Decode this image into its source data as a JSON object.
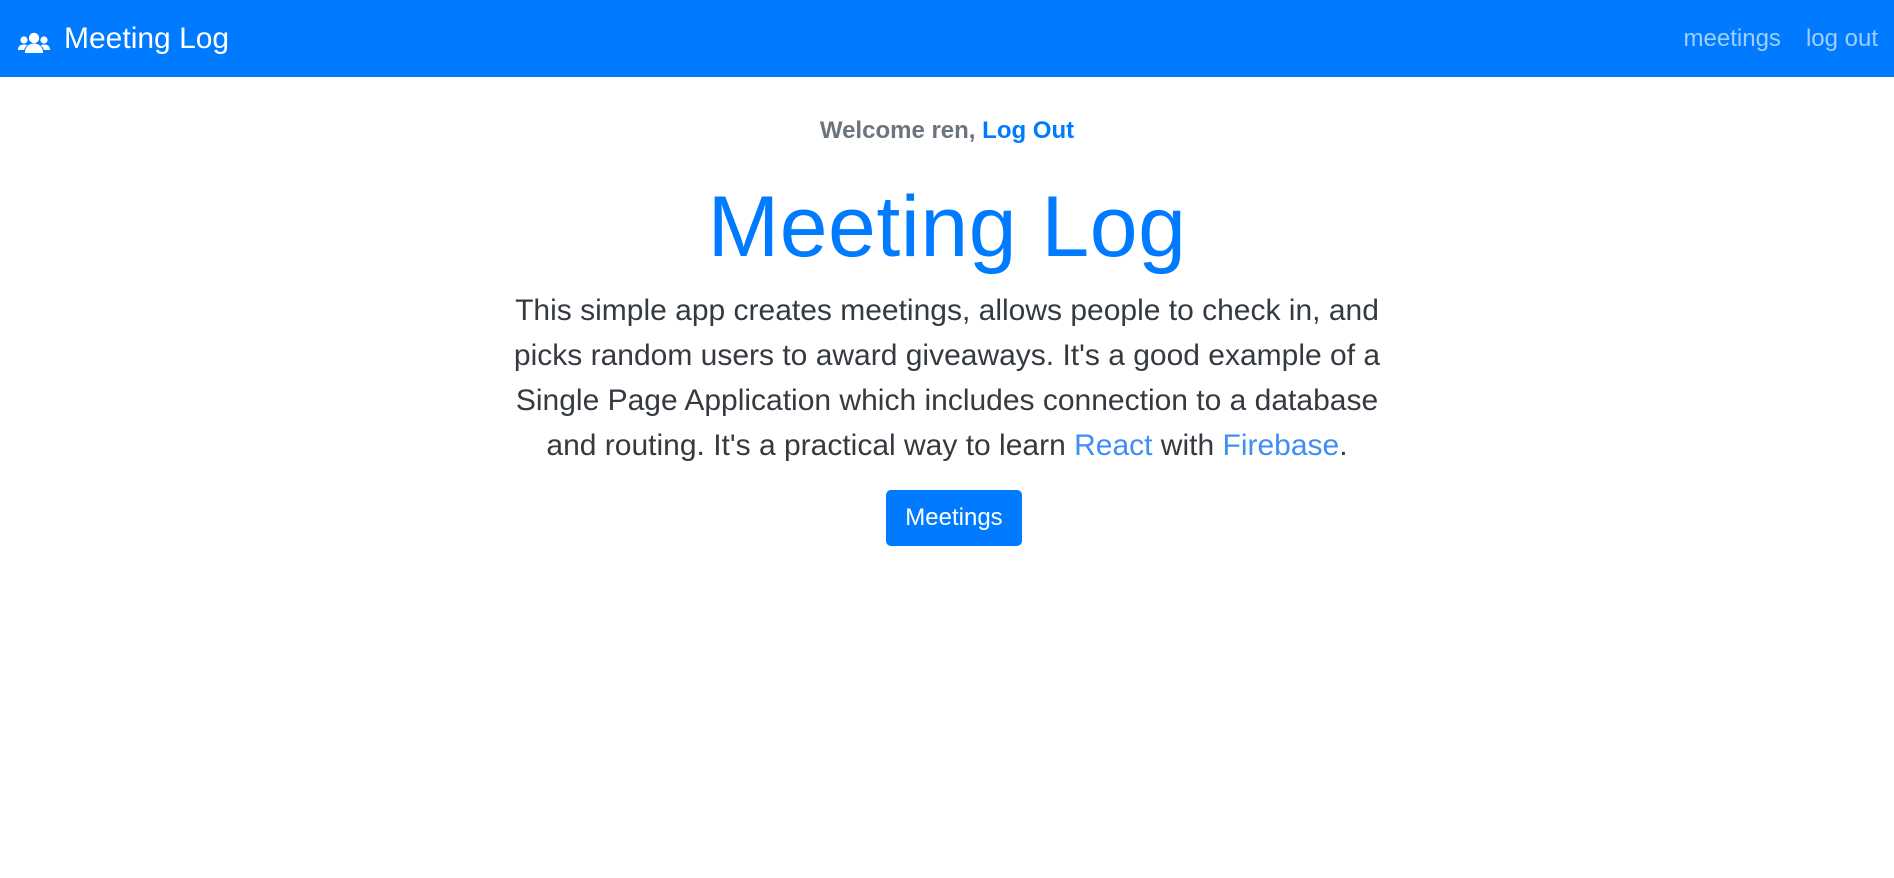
{
  "navbar": {
    "brand_icon": "users-icon",
    "brand_label": "Meeting Log",
    "links": [
      {
        "label": "meetings"
      },
      {
        "label": "log out"
      }
    ]
  },
  "welcome": {
    "prefix": "Welcome ren,",
    "logout_label": "Log Out"
  },
  "main": {
    "title": "Meeting Log",
    "description_part1": "This simple app creates meetings, allows people to check in, and picks random users to award giveaways. It's a good example of a Single Page Application which includes connection to a database and routing. It's a practical way to learn ",
    "react_link": "React",
    "description_part2": " with ",
    "firebase_link": "Firebase",
    "description_part3": ".",
    "button_label": "Meetings"
  },
  "colors": {
    "primary": "#007bff",
    "muted": "#6c757d",
    "text": "#343a40"
  }
}
